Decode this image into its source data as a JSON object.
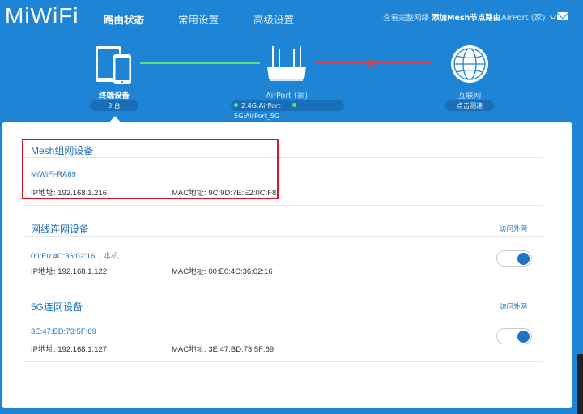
{
  "header": {
    "logo": "MiWiFi",
    "tabs": [
      {
        "label": "路由状态",
        "active": true
      },
      {
        "label": "常用设置",
        "active": false
      },
      {
        "label": "高级设置",
        "active": false
      }
    ],
    "view_network_link": "查看完整网络",
    "add_mesh_link": "添加Mesh节点路由",
    "router_menu": "AirPort (家)"
  },
  "topology": {
    "devices": {
      "label": "终端设备",
      "count": "3 台"
    },
    "router": {
      "label": "AirPort (家)",
      "wifi_24": "2.4G:AirPort",
      "wifi_5": "5G:AirPort_5G"
    },
    "internet": {
      "label": "互联网",
      "action": "点击测速"
    },
    "colors": {
      "connected": "#5fe07a",
      "disconnected": "#e3394a"
    }
  },
  "sections": {
    "mesh": {
      "title": "Mesh组网设备",
      "device": {
        "name": "MiWiFi-RA69",
        "ip": "IP地址: 192.168.1.216",
        "mac": "MAC地址: 9C:9D:7E:E2:0C:F8"
      }
    },
    "wired": {
      "title": "网线连网设备",
      "action": "访问外网",
      "device": {
        "name": "00:E0:4C:36:02:16",
        "tag": "本机",
        "ip": "IP地址: 192.168.1.122",
        "mac": "MAC地址: 00:E0:4C:36:02:16",
        "internet_access": true
      }
    },
    "wifi5g": {
      "title": "5G连网设备",
      "action": "访问外网",
      "device": {
        "name": "3E:47:BD:73:5F:69",
        "ip": "IP地址: 192.168.1.127",
        "mac": "MAC地址: 3E:47:BD:73:5F:69",
        "internet_access": true
      }
    }
  }
}
